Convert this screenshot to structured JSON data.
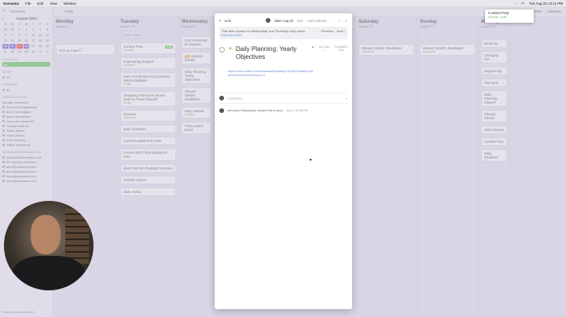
{
  "menubar": {
    "app": "Sunsama",
    "items": [
      "File",
      "Edit",
      "View",
      "Window"
    ],
    "clock": "Tue Aug 22  12:11 PM"
  },
  "sidebar": {
    "brand": "Sunsama",
    "calendar": {
      "month": "August 2023",
      "weekdays": [
        "S",
        "M",
        "T",
        "W",
        "T",
        "F",
        "S"
      ],
      "days": [
        "30",
        "31",
        "1",
        "2",
        "3",
        "4",
        "5",
        "6",
        "7",
        "8",
        "9",
        "10",
        "11",
        "12",
        "13",
        "14",
        "15",
        "16",
        "17",
        "18",
        "19",
        "20",
        "21",
        "22",
        "23",
        "24",
        "25",
        "26",
        "27",
        "28",
        "29",
        "30",
        "31",
        "1",
        "2"
      ]
    },
    "sections": [
      {
        "title": "CHANNELS",
        "items": [
          "all"
        ]
      },
      {
        "title": "WORK",
        "items": [
          "all"
        ]
      },
      {
        "title": "PERSONAL",
        "items": [
          "all"
        ]
      },
      {
        "title": "UNCATEGORIZED",
        "items": [
          "Manage Channels"
        ]
      }
    ],
    "people": [
      "Ashutosh Priyadarshy",
      "Alex Cunningham",
      "Bruno Bernardino",
      "Jeep van Hardeveld",
      "Joseph Cofaneli",
      "Travis Meyer",
      "Yash Chavan",
      "Zane Mooney",
      "Vishal Jaisimhulu"
    ],
    "accounts_title": "SUNSAMA@SUNSAMA.COM",
    "accounts": [
      "ashutosh@sunsama.com",
      "AP Working Sessions",
      "ashu@sunsama.com",
      "travel@sunsama.com",
      "team@sunsama.com",
      "sarah@sunsama.com"
    ],
    "footer": "Make sunsama default"
  },
  "topbar": {
    "today_label": "Today",
    "tasks_tab": "Tasks",
    "calendar_tab": "Calendar"
  },
  "columns": [
    {
      "day": "Monday",
      "date": "August 21",
      "cards": [
        {
          "title": "Pick up Cater",
          "time": "",
          "tag": ""
        }
      ]
    },
    {
      "day": "Tuesday",
      "date": "August 22",
      "cards": [
        {
          "title": "Content Prep",
          "time": "0:45",
          "tag": "# growth"
        },
        {
          "title": "Engineering Support",
          "time": "",
          "tag": "# support"
        },
        {
          "title": "User commit (service) particular Notion database",
          "time": "",
          "tag": "# bugs"
        },
        {
          "title": "Swapping timezones causes tasks to \"move forward\"",
          "time": "",
          "tag": "# bugs"
        },
        {
          "title": "Reviews",
          "time": "",
          "tag": "# planning"
        },
        {
          "title": "Daily shutdown",
          "time": "",
          "tag": ""
        },
        {
          "title": "Launch/Capital and Cards",
          "time": "",
          "tag": ""
        },
        {
          "title": "Invoice REFS from Brainstorm Lists",
          "time": "",
          "tag": ""
        },
        {
          "title": "Book Pan Pan Findings Sunsama",
          "time": "",
          "tag": ""
        },
        {
          "title": "Refresh Videos",
          "time": "",
          "tag": ""
        },
        {
          "title": "Daily review",
          "time": "",
          "tag": ""
        }
      ],
      "add_task": "+ Add a task"
    },
    {
      "day": "Wednesday",
      "date": "August 23",
      "cards": [
        {
          "title": "CSV Download for Reports",
          "time": "",
          "tag": ""
        },
        {
          "title": "Vacation Kickoff",
          "time": "",
          "tag": ""
        },
        {
          "title": "Daily Planning: Yearly Objectives",
          "time": "",
          "tag": ""
        },
        {
          "title": "Shower, Stretch, Meditation",
          "time": "",
          "tag": ""
        },
        {
          "title": "Daily inboxes",
          "time": "",
          "tag": "# admin"
        },
        {
          "title": "Prep Launch Email",
          "time": "",
          "tag": ""
        }
      ]
    },
    {
      "day": "Saturday",
      "date": "August 26",
      "cards": [
        {
          "title": "Shower, Stretch, Meditation",
          "time": "",
          "tag": "# personal"
        }
      ]
    },
    {
      "day": "Sunday",
      "date": "August 27",
      "cards": [
        {
          "title": "Shower, Stretch, Meditation",
          "time": "",
          "tag": "# personal"
        }
      ]
    },
    {
      "day": "Monday",
      "date": "August 28",
      "cards": [
        {
          "title": "Read Alo",
          "time": "",
          "tag": ""
        },
        {
          "title": "Changing Get",
          "time": "",
          "tag": ""
        },
        {
          "title": "Engineering",
          "time": "",
          "tag": ""
        },
        {
          "title": "Pay Bank",
          "time": "",
          "tag": ""
        },
        {
          "title": "Daily Planning Support",
          "time": "",
          "tag": ""
        },
        {
          "title": "Shower, Stretch",
          "time": "",
          "tag": ""
        },
        {
          "title": "Daily inboxes",
          "time": "",
          "tag": ""
        },
        {
          "title": "Content Prep",
          "time": "",
          "tag": ""
        },
        {
          "title": "Daily shutdown",
          "time": "",
          "tag": ""
        }
      ]
    }
  ],
  "modal": {
    "channel": "work",
    "start": "Start: Aug 23",
    "due": "Due",
    "add_subtasks": "Add subtasks",
    "repeat_text": "This task repeats on Wednesday, and Thursday every week.",
    "repeat_link": "Edit task series",
    "prev": "‹ Previous",
    "next": "Next ›",
    "title": "Daily Planning: Yearly Objectives",
    "actual_label": "ACTUAL",
    "actual_value": "--:--",
    "planned_label": "PLANNED",
    "planned_value": "0:15",
    "url": "https://www.notion.so/sunsama/Roadmap-7b0857bebbbe420af9bc51ce2fe1932f?pvs=4",
    "comment_placeholder": "Comment...",
    "activity": "Ashutosh Priyadarshy created this in work",
    "activity_time": "Jun 2, 12:08 PM"
  },
  "notification": {
    "title": "Content Prep",
    "time": "0:01:51 / 0:45"
  },
  "colors": {
    "accent": "#6c5fc7",
    "green": "#5fbf5a",
    "link": "#6a8bd6"
  }
}
